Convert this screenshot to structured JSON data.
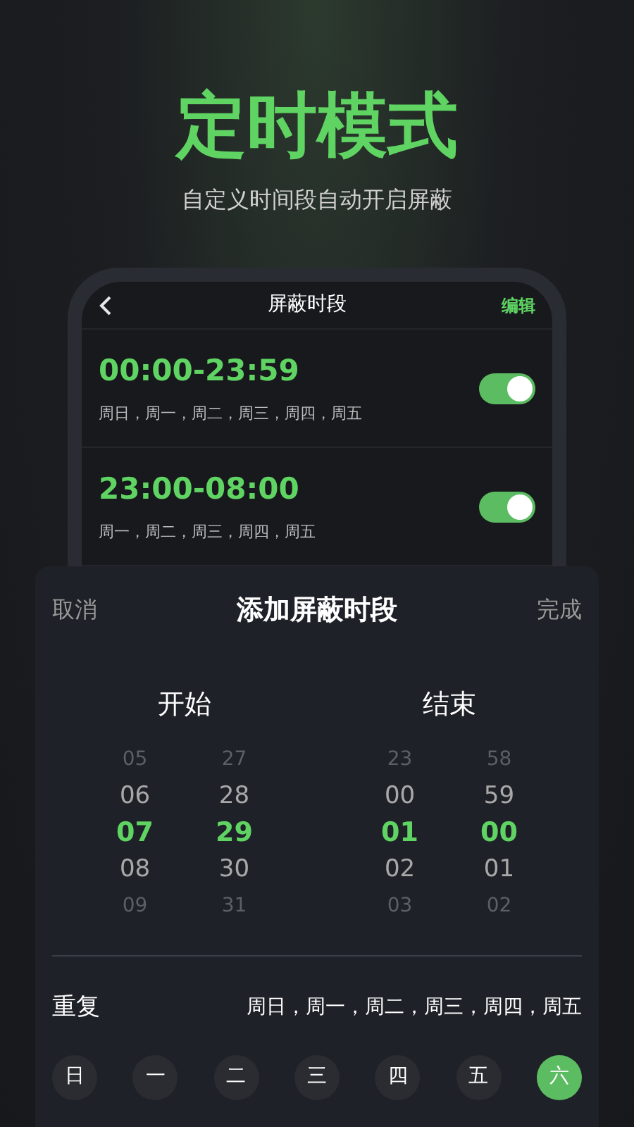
{
  "hero": {
    "title": "定时模式",
    "subtitle": "自定义时间段自动开启屏蔽"
  },
  "phone": {
    "title": "屏蔽时段",
    "action": "编辑",
    "schedules": [
      {
        "time": "00:00-23:59",
        "days": "周日，周一，周二，周三，周四，周五",
        "on": true
      },
      {
        "time": "23:00-08:00",
        "days": "周一，周二，周三，周四，周五",
        "on": true
      }
    ]
  },
  "sheet": {
    "cancel": "取消",
    "title": "添加屏蔽时段",
    "done": "完成",
    "columns": [
      {
        "label": "开始",
        "wheels": [
          [
            {
              "text": "05",
              "selected": false
            },
            {
              "text": "06",
              "selected": false
            },
            {
              "text": "07",
              "selected": true
            },
            {
              "text": "08",
              "selected": false
            },
            {
              "text": "09",
              "selected": false
            }
          ],
          [
            {
              "text": "27",
              "selected": false
            },
            {
              "text": "28",
              "selected": false
            },
            {
              "text": "29",
              "selected": true
            },
            {
              "text": "30",
              "selected": false
            },
            {
              "text": "31",
              "selected": false
            }
          ]
        ]
      },
      {
        "label": "结束",
        "wheels": [
          [
            {
              "text": "23",
              "selected": false
            },
            {
              "text": "00",
              "selected": false
            },
            {
              "text": "01",
              "selected": true
            },
            {
              "text": "02",
              "selected": false
            },
            {
              "text": "03",
              "selected": false
            }
          ],
          [
            {
              "text": "58",
              "selected": false
            },
            {
              "text": "59",
              "selected": false
            },
            {
              "text": "00",
              "selected": true
            },
            {
              "text": "01",
              "selected": false
            },
            {
              "text": "02",
              "selected": false
            }
          ]
        ]
      }
    ],
    "repeat": {
      "label": "重复",
      "value": "周日，周一，周二，周三，周四，周五",
      "days": [
        {
          "label": "日",
          "selected": false
        },
        {
          "label": "一",
          "selected": false
        },
        {
          "label": "二",
          "selected": false
        },
        {
          "label": "三",
          "selected": false
        },
        {
          "label": "四",
          "selected": false
        },
        {
          "label": "五",
          "selected": false
        },
        {
          "label": "六",
          "selected": true
        }
      ]
    }
  }
}
